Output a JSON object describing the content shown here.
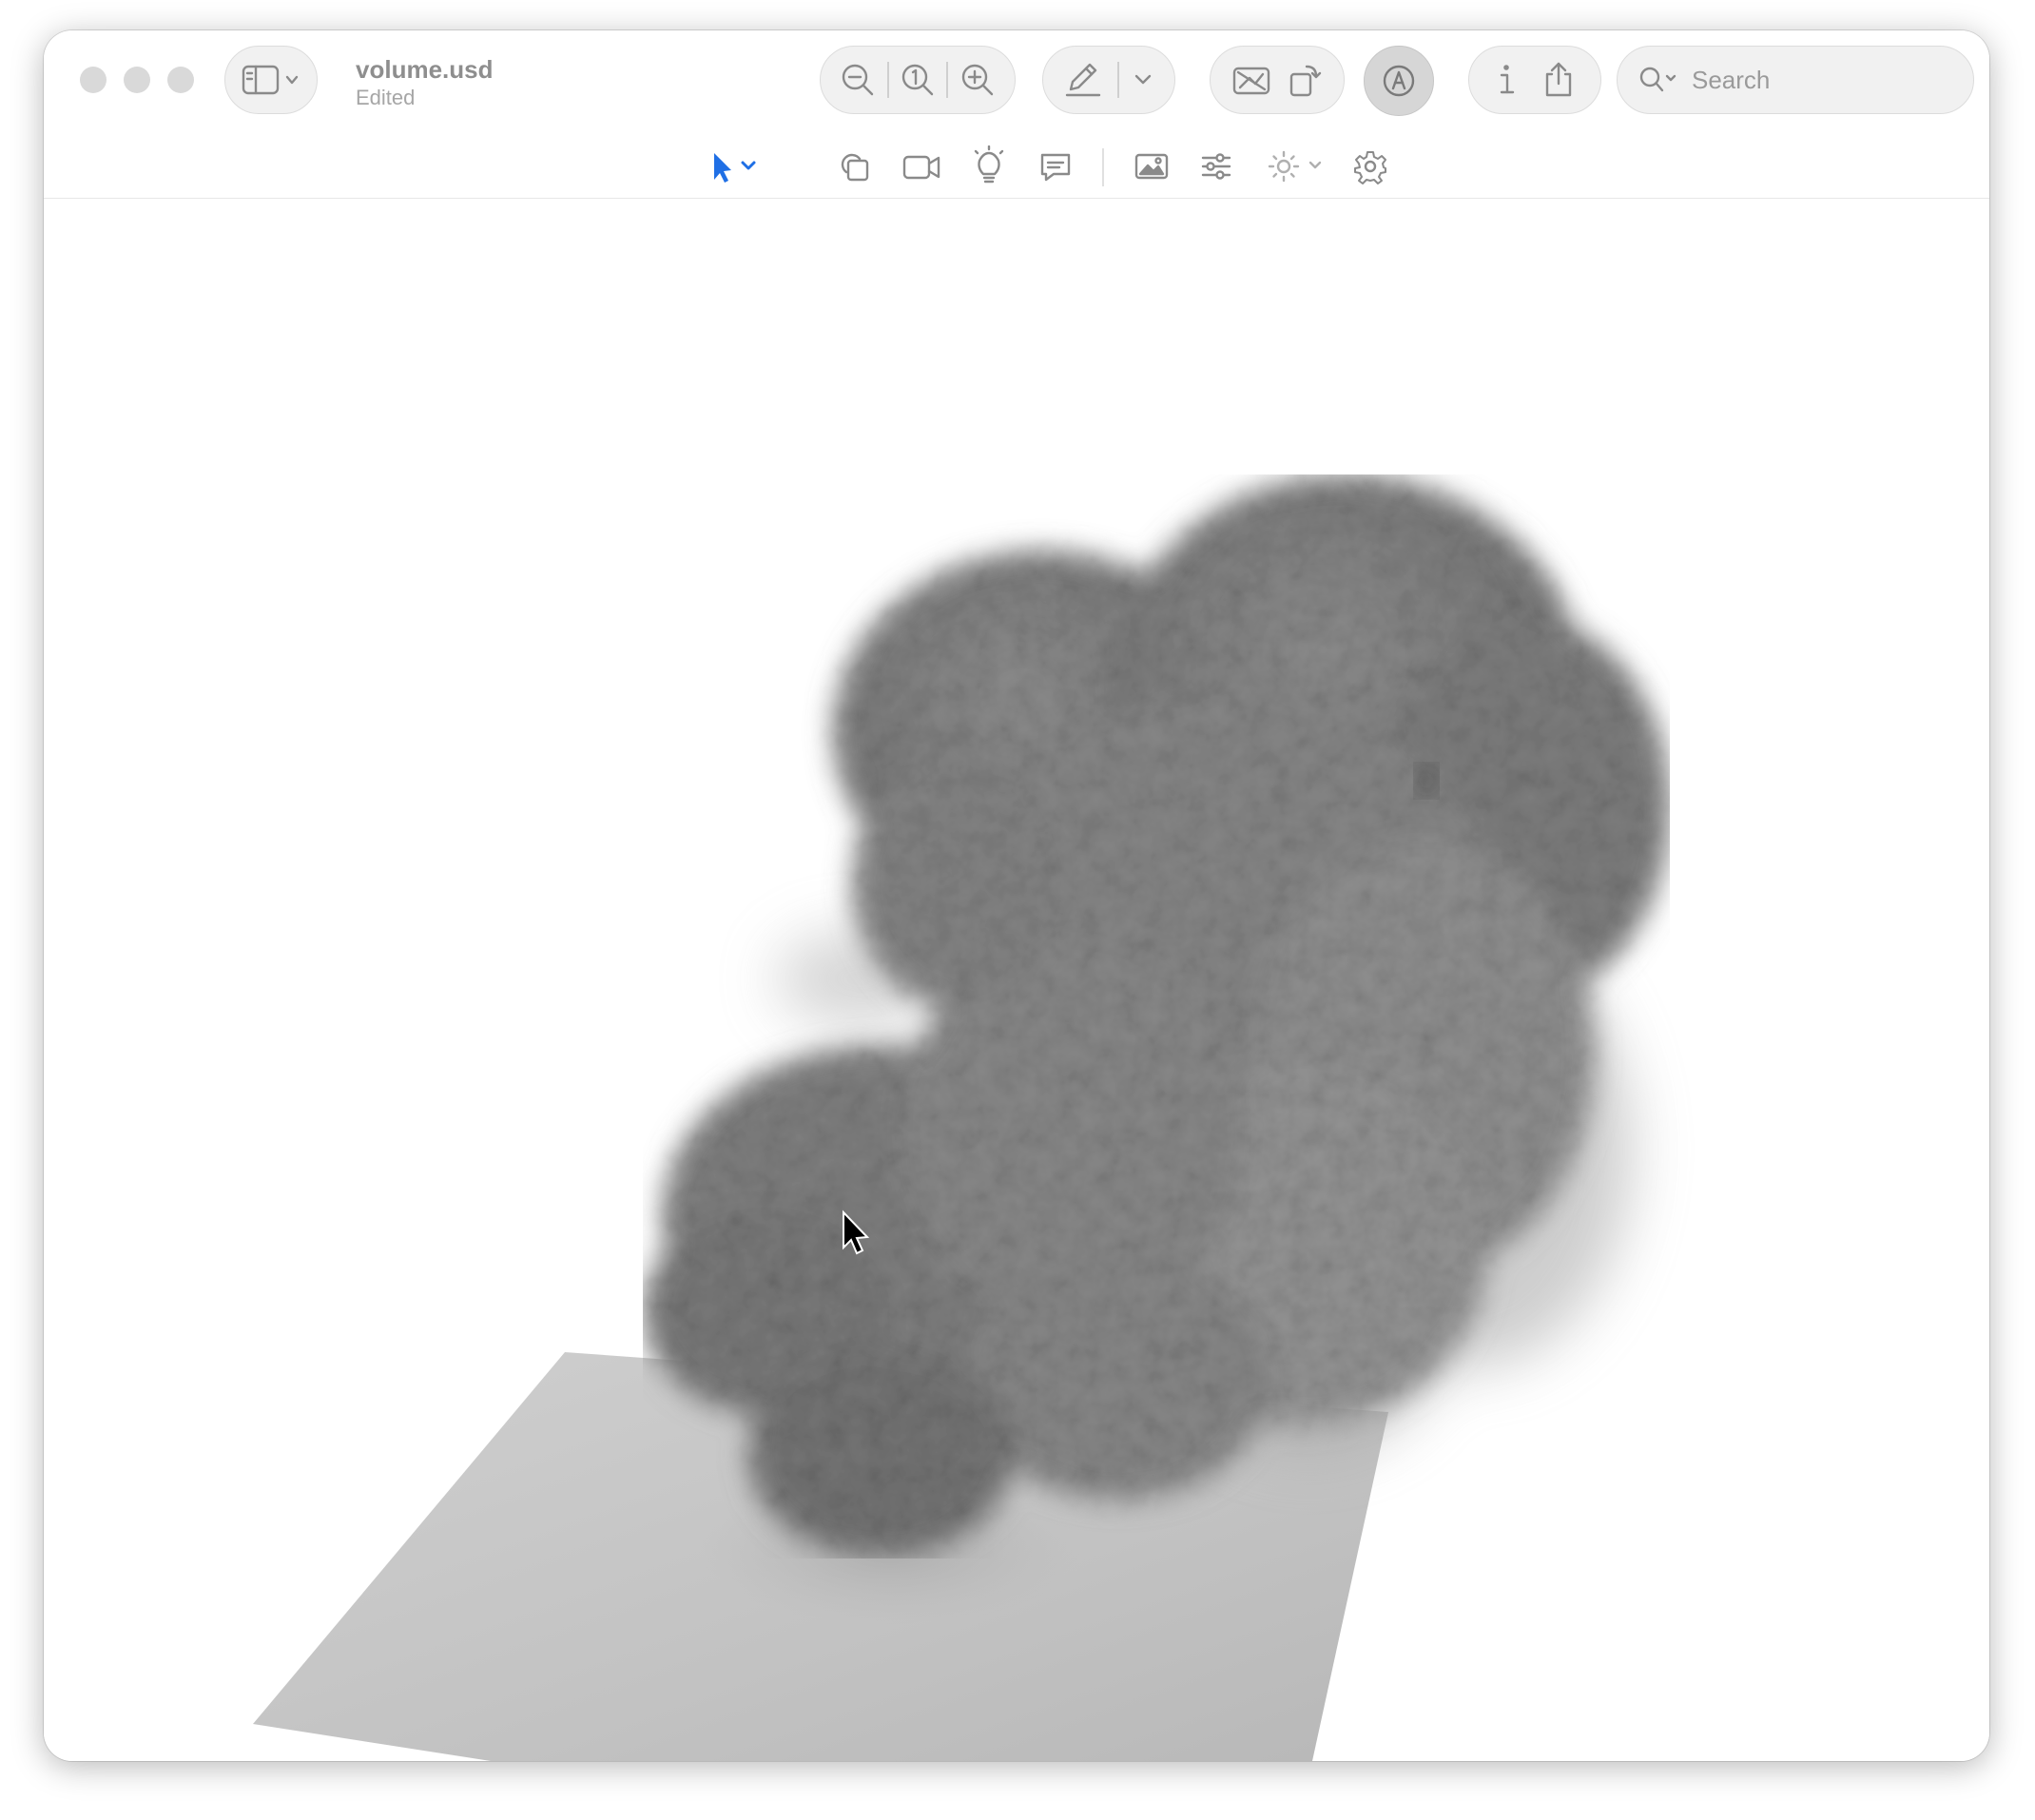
{
  "window": {
    "title": "volume.usd",
    "status": "Edited"
  },
  "toolbar": {
    "sidebar_toggle_icon": "sidebar-icon",
    "zoom_out_icon": "zoom-out-icon",
    "actual_size_icon": "actual-size-icon",
    "zoom_in_icon": "zoom-in-icon",
    "annotate_icon": "pencil-icon",
    "snapshot_icon": "snapshot-icon",
    "rotate_icon": "rotate-icon",
    "markup_icon": "markup-icon",
    "info_icon": "info-icon",
    "share_icon": "share-icon",
    "search_placeholder": "Search"
  },
  "secondary_toolbar": {
    "tools": [
      "select-arrow-icon",
      "objects-icon",
      "camera-icon",
      "light-icon",
      "comment-icon",
      "image-icon",
      "adjust-icon",
      "brightness-icon",
      "gear-icon"
    ]
  },
  "colors": {
    "accent": "#1f6fe5",
    "icon": "#8a8a8a",
    "smoke": "#7d7d7d",
    "floor": "#c4c4c4"
  }
}
